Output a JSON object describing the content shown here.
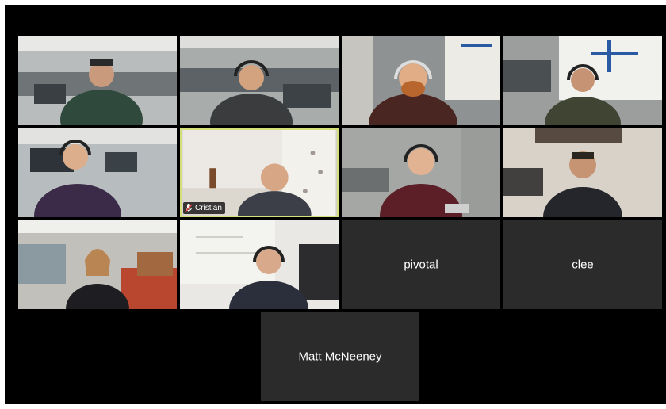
{
  "participants": [
    {
      "id": "p1",
      "name": "",
      "video": true
    },
    {
      "id": "p2",
      "name": "",
      "video": true
    },
    {
      "id": "p3",
      "name": "",
      "video": true
    },
    {
      "id": "p4",
      "name": "",
      "video": true
    },
    {
      "id": "p5",
      "name": "",
      "video": true
    },
    {
      "id": "p6",
      "name": "Cristian",
      "video": true,
      "active_speaker": true,
      "muted": true
    },
    {
      "id": "p7",
      "name": "",
      "video": true
    },
    {
      "id": "p8",
      "name": "",
      "video": true
    },
    {
      "id": "p9",
      "name": "",
      "video": true
    },
    {
      "id": "p10",
      "name": "",
      "video": true
    },
    {
      "id": "p11",
      "name": "pivotal",
      "video": false
    },
    {
      "id": "p12",
      "name": "clee",
      "video": false
    },
    {
      "id": "p13",
      "name": "Matt McNeeney",
      "video": false
    }
  ],
  "colors": {
    "background": "#000000",
    "tile_off": "#2b2b2b",
    "active_border": "#d6e07a",
    "muted_icon": "#e0403a"
  },
  "icons": {
    "muted": "mic-off-icon"
  }
}
